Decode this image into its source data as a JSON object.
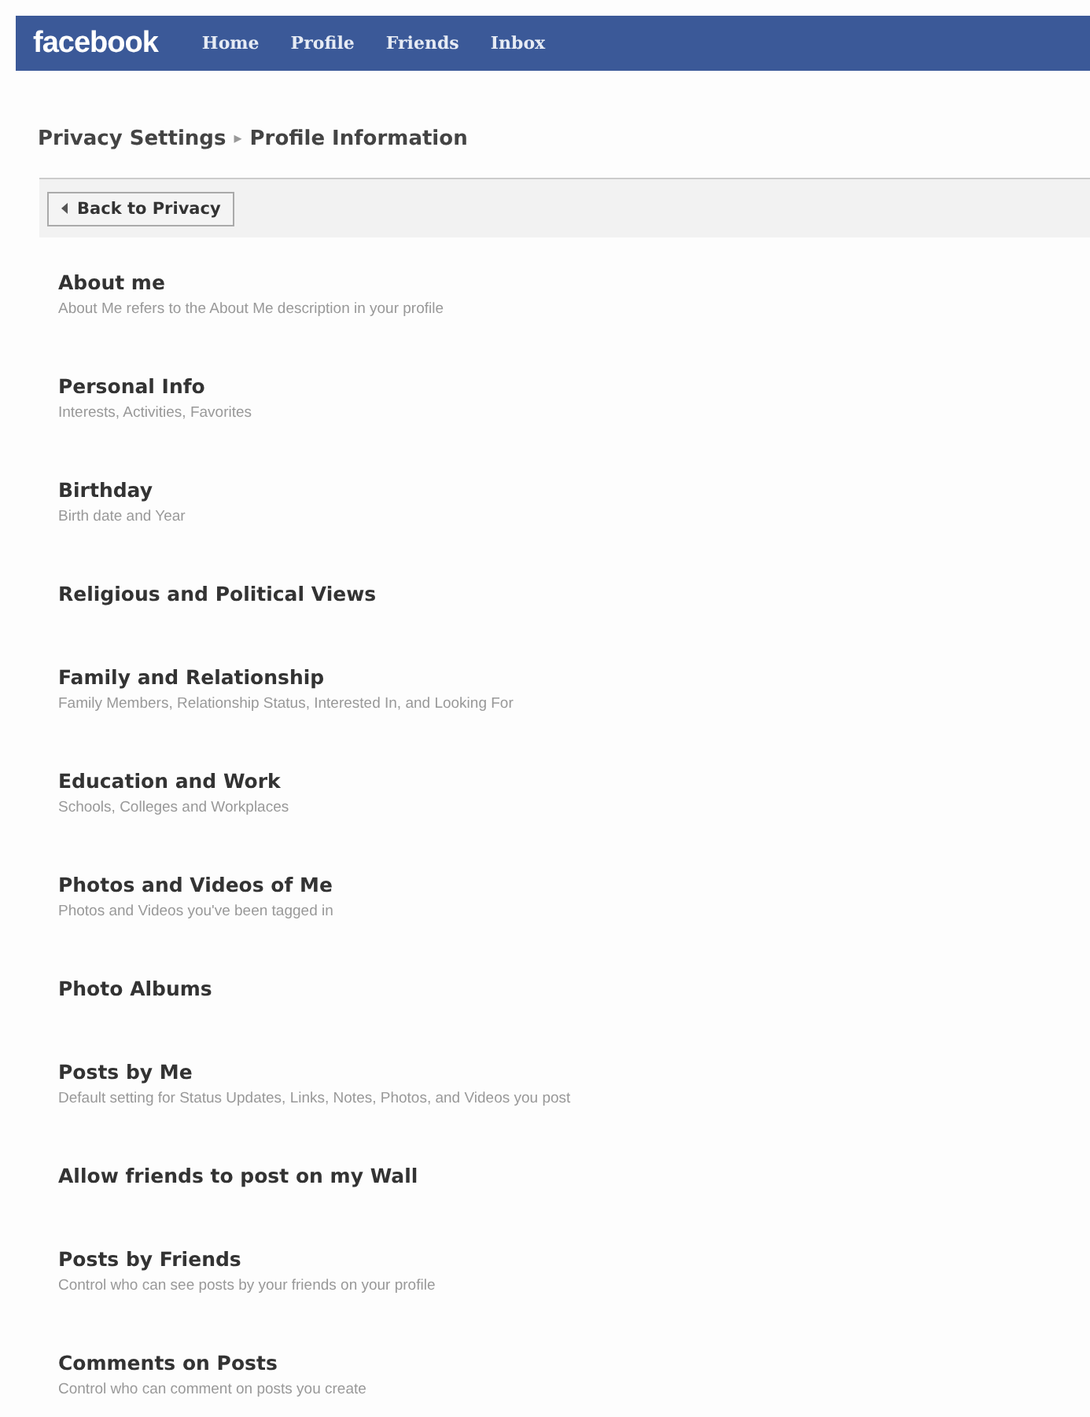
{
  "header": {
    "logo": "facebook",
    "nav": [
      "Home",
      "Profile",
      "Friends",
      "Inbox"
    ]
  },
  "breadcrumb": {
    "parent": "Privacy Settings",
    "separator": "▸",
    "current": "Profile Information"
  },
  "back_button": {
    "label": "Back to Privacy"
  },
  "settings": [
    {
      "title": "About me",
      "description": "About Me refers to the About Me description in your profile"
    },
    {
      "title": "Personal Info",
      "description": "Interests, Activities, Favorites"
    },
    {
      "title": "Birthday",
      "description": "Birth date and Year"
    },
    {
      "title": "Religious and Political Views"
    },
    {
      "title": "Family and Relationship",
      "description": "Family Members, Relationship Status, Interested In, and Looking For"
    },
    {
      "title": "Education and Work",
      "description": "Schools, Colleges and Workplaces"
    },
    {
      "title": "Photos and Videos of Me",
      "description": "Photos and Videos you've been tagged in"
    },
    {
      "title": "Photo Albums"
    },
    {
      "title": "Posts by Me",
      "description": "Default setting for Status Updates, Links, Notes, Photos, and Videos you post"
    },
    {
      "title": "Allow friends to post on my Wall"
    },
    {
      "title": "Posts by Friends",
      "description": "Control who can see posts by your friends on your profile"
    },
    {
      "title": "Comments on Posts",
      "description": "Control who can comment on posts you create"
    }
  ]
}
